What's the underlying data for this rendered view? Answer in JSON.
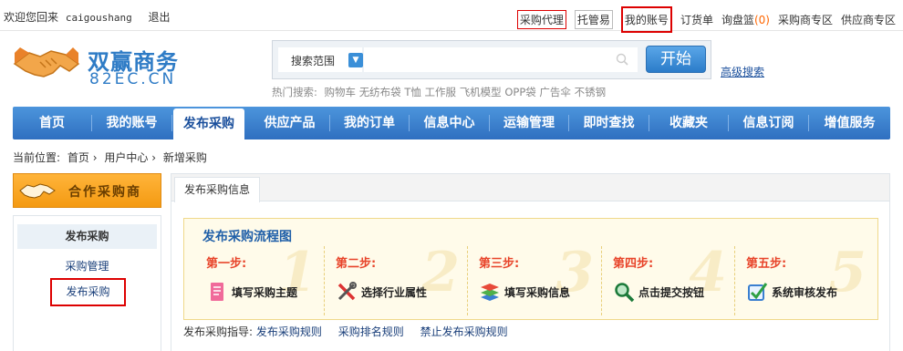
{
  "topbar": {
    "welcome": "欢迎您回来",
    "username": "caigoushang",
    "logout": "退出",
    "links": [
      {
        "label": "采购代理",
        "style": "boxed"
      },
      {
        "label": "托管易",
        "style": "boxed-grey"
      },
      {
        "label": "我的账号",
        "style": "boxed-strong"
      },
      {
        "label": "订货单",
        "style": "plain"
      },
      {
        "label": "询盘篮",
        "count": "(0)",
        "style": "plain"
      },
      {
        "label": "采购商专区",
        "style": "plain"
      },
      {
        "label": "供应商专区",
        "style": "plain"
      }
    ]
  },
  "logo": {
    "title": "双赢商务",
    "subtitle": "82EC.CN"
  },
  "search": {
    "scope_label": "搜索范围",
    "placeholder": "",
    "button": "开始",
    "advanced": "高级搜索"
  },
  "hot": {
    "label": "热门搜索:",
    "terms": [
      "购物车",
      "无纺布袋",
      "T恤",
      "工作服",
      "飞机模型",
      "OPP袋",
      "广告伞",
      "不锈钢"
    ]
  },
  "nav": {
    "items": [
      "首页",
      "我的账号",
      "发布采购",
      "供应产品",
      "我的订单",
      "信息中心",
      "运输管理",
      "即时查找",
      "收藏夹",
      "信息订阅",
      "增值服务"
    ],
    "active_index": 2
  },
  "breadcrumb": {
    "label": "当前位置:",
    "items": [
      "首页",
      "用户中心",
      "新增采购"
    ],
    "sep": "›"
  },
  "sidebar": {
    "banner": "合作采购商",
    "head": "发布采购",
    "items": [
      "采购管理",
      "发布采购"
    ],
    "selected_index": 1
  },
  "panel": {
    "tab": "发布采购信息",
    "flow_title": "发布采购流程图",
    "steps": [
      {
        "label": "第一步:",
        "text": "填写采购主题",
        "num": "1",
        "icon": "document-icon"
      },
      {
        "label": "第二步:",
        "text": "选择行业属性",
        "num": "2",
        "icon": "tools-icon"
      },
      {
        "label": "第三步:",
        "text": "填写采购信息",
        "num": "3",
        "icon": "layers-icon"
      },
      {
        "label": "第四步:",
        "text": "点击提交按钮",
        "num": "4",
        "icon": "magnifier-icon"
      },
      {
        "label": "第五步:",
        "text": "系统审核发布",
        "num": "5",
        "icon": "checkbox-icon"
      }
    ],
    "guide_label": "发布采购指导:",
    "guide_links": [
      "发布采购规则",
      "采购排名规则",
      "禁止发布采购规则"
    ]
  },
  "colors": {
    "nav_blue": "#2f6fc0",
    "brand_blue": "#2f7cc6",
    "highlight_red": "#dd0000",
    "step_red": "#e8442a",
    "banner_orange": "#f49a12"
  }
}
